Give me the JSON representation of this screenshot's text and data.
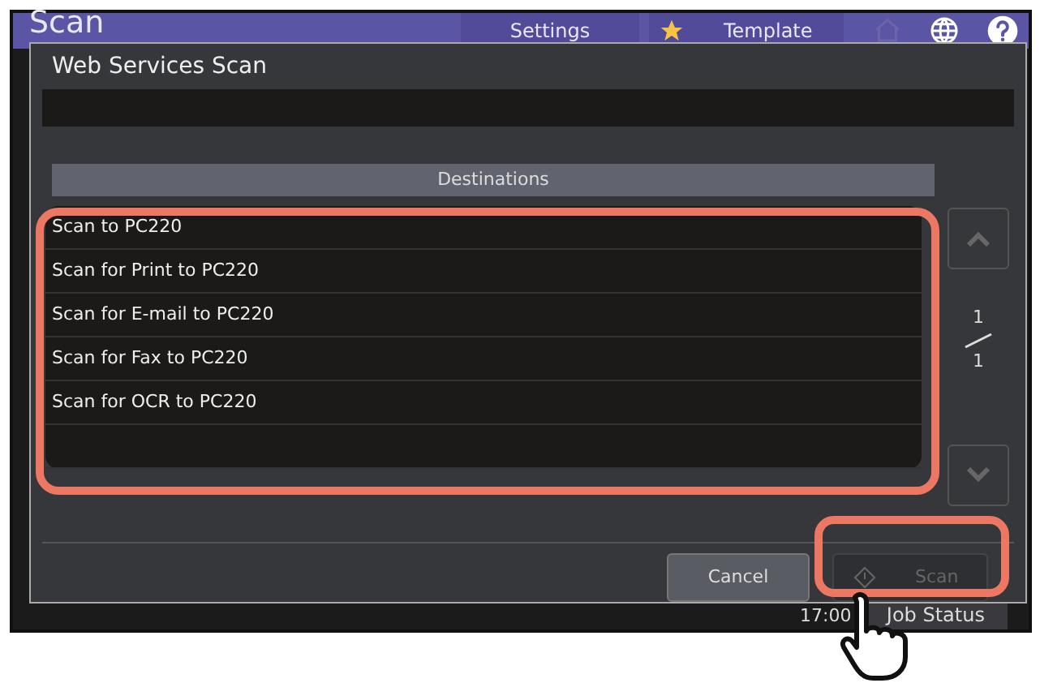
{
  "screen": {
    "title": "Scan",
    "settings_label": "Settings",
    "template_label": "Template",
    "time": "17:00",
    "job_status": "Job Status"
  },
  "dialog": {
    "title": "Web Services Scan",
    "list_header": "Destinations",
    "destinations": [
      "Scan to PC220",
      "Scan for Print to PC220",
      "Scan for E-mail to PC220",
      "Scan for Fax to PC220",
      "Scan for OCR to PC220"
    ],
    "page": "1",
    "pages": "1",
    "buttons": [
      {
        "label": "Cancel",
        "disabled": false
      },
      {
        "label": "Scan",
        "disabled": true
      }
    ]
  }
}
